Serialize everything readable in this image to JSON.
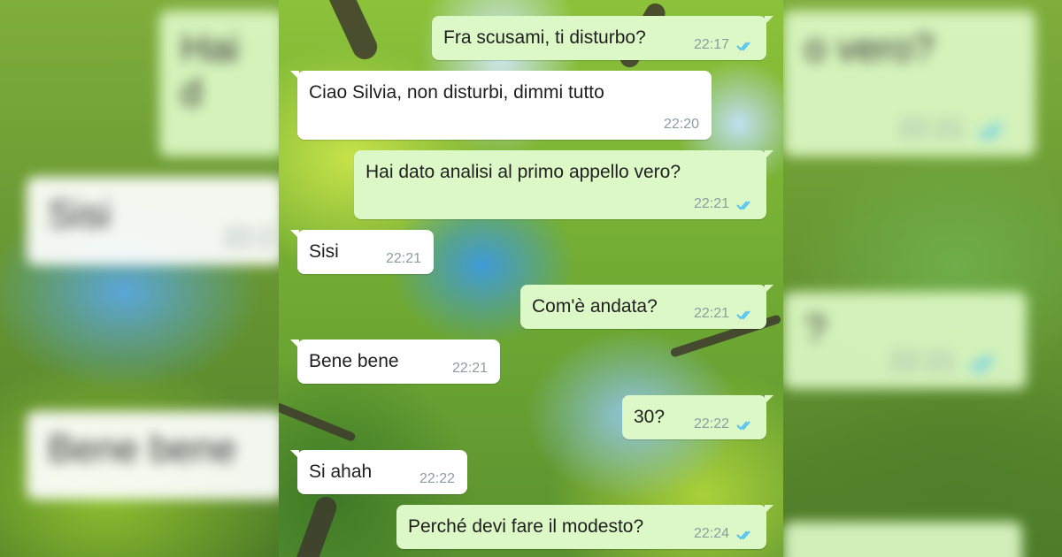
{
  "colors": {
    "incoming_bubble": "#ffffff",
    "outgoing_bubble": "#dcf8c6",
    "read_tick": "#4fc3f7",
    "time_text": "#8c9ca3"
  },
  "icons": {
    "read_receipt": "double-check-icon"
  },
  "messages": [
    {
      "direction": "out",
      "text": "Fra scusami, ti disturbo?",
      "time": "22:17",
      "read": true
    },
    {
      "direction": "in",
      "text": "Ciao Silvia, non disturbi, dimmi tutto",
      "time": "22:20"
    },
    {
      "direction": "out",
      "text": "Hai dato analisi al primo appello vero?",
      "time": "22:21",
      "read": true
    },
    {
      "direction": "in",
      "text": "Sisi",
      "time": "22:21"
    },
    {
      "direction": "out",
      "text": "Com'è andata?",
      "time": "22:21",
      "read": true
    },
    {
      "direction": "in",
      "text": "Bene bene",
      "time": "22:21"
    },
    {
      "direction": "out",
      "text": "30?",
      "time": "22:22",
      "read": true
    },
    {
      "direction": "in",
      "text": "Si ahah",
      "time": "22:22"
    },
    {
      "direction": "out",
      "text": "Perché devi fare il modesto?",
      "time": "22:24",
      "read": true
    }
  ],
  "backdrop_ghosts": {
    "top_right_text": "Hai d",
    "top_right_text2": "o vero?",
    "top_right_time": "22:21",
    "left_sisi": "Sisi",
    "left_sisi_time": "22:2",
    "right_mid_text": "?",
    "right_mid_time": "22:21",
    "left_bene": "Bene bene"
  }
}
